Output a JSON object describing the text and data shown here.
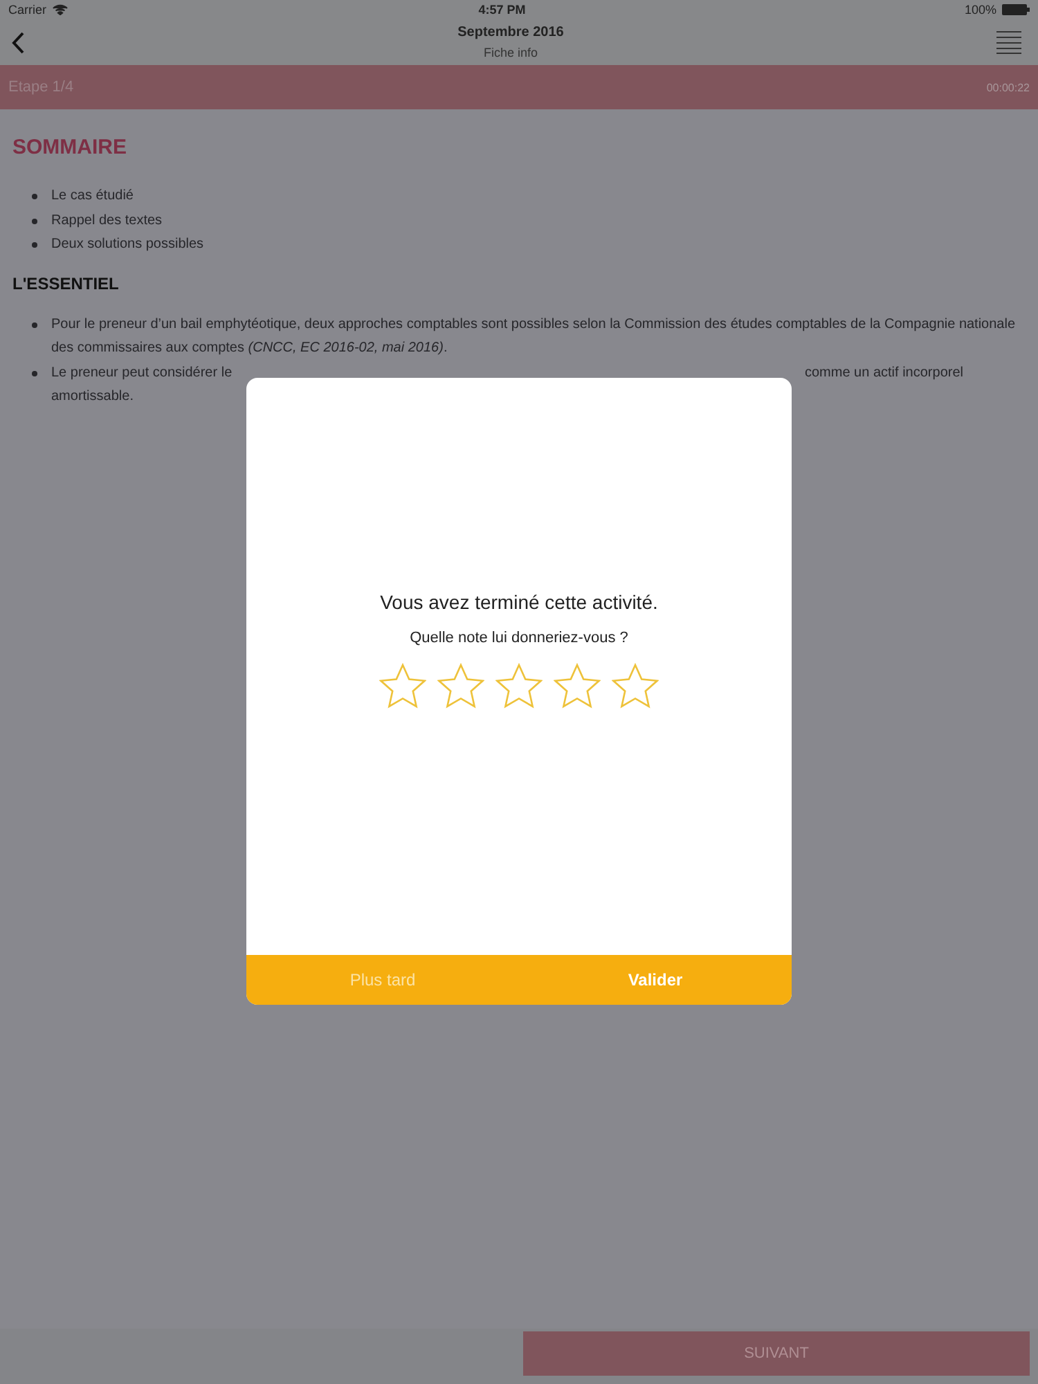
{
  "status_bar": {
    "carrier": "Carrier",
    "time": "4:57 PM",
    "battery": "100%"
  },
  "nav": {
    "title": "Septembre 2016",
    "subtitle": "Fiche info"
  },
  "step_bar": {
    "step": "Etape 1/4",
    "timer": "00:00:22"
  },
  "sommaire": {
    "title": "SOMMAIRE",
    "items": [
      "Le cas étudié",
      "Rappel des textes",
      "Deux solutions possibles"
    ]
  },
  "essentiel": {
    "title": "L'ESSENTIEL",
    "items": [
      {
        "text": "Pour le preneur d’un bail emphytéotique, deux approches comptables sont possibles selon la Commission des études comptables de la Compagnie nationale des commissaires aux comptes *(CNCC, EC 2016-02, mai 2016)*."
      },
      {
        "text_left": "Le preneur peut considérer le",
        "text_right": "comme un actif incorporel",
        "text_end": "amortissable."
      }
    ]
  },
  "dialog": {
    "title": "Vous avez terminé cette activité.",
    "question": "Quelle note lui donneriez-vous ?",
    "stars": 0,
    "buttons": [
      {
        "label": "Plus tard",
        "kind": "secondary"
      },
      {
        "label": "Valider",
        "kind": "primary"
      }
    ]
  },
  "next_button": "SUIVANT"
}
